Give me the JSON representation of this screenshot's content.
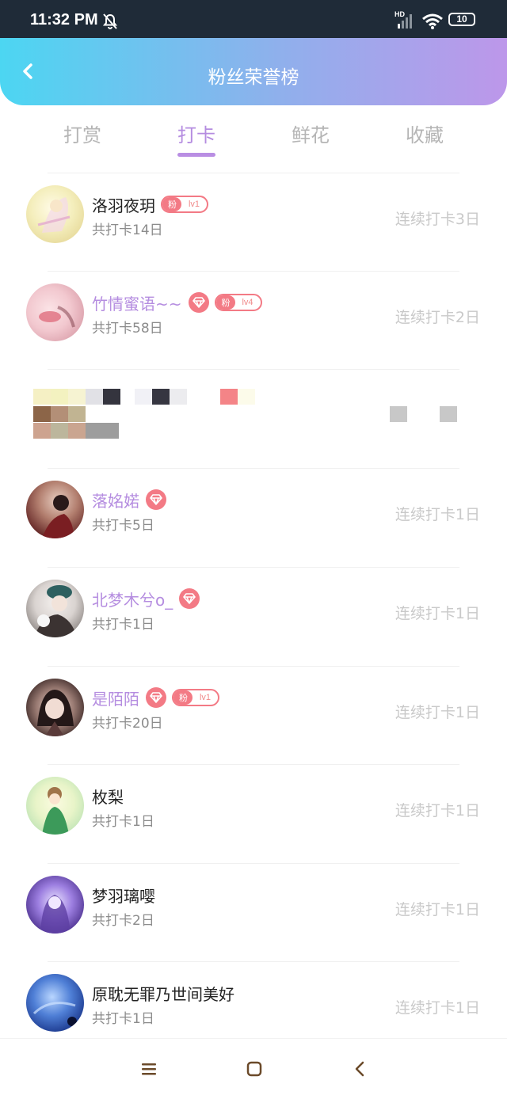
{
  "status": {
    "time": "11:32 PM",
    "battery": "10",
    "hd": "HD"
  },
  "header": {
    "title": "粉丝荣誉榜"
  },
  "tabs": [
    {
      "label": "打赏"
    },
    {
      "label": "打卡"
    },
    {
      "label": "鲜花"
    },
    {
      "label": "收藏"
    }
  ],
  "fan_badge_char": "粉",
  "rows": [
    {
      "name": "洛羽夜玥",
      "days": "共打卡14日",
      "streak": "连续打卡3日",
      "level": "lv1"
    },
    {
      "name": "竹情蜜语~~",
      "days": "共打卡58日",
      "streak": "连续打卡2日",
      "level": "lv4"
    },
    {
      "name": "落姳婼",
      "days": "共打卡5日",
      "streak": "连续打卡1日"
    },
    {
      "name": "北梦木兮o_",
      "days": "共打卡1日",
      "streak": "连续打卡1日"
    },
    {
      "name": "是陌陌",
      "days": "共打卡20日",
      "streak": "连续打卡1日",
      "level": "lv1"
    },
    {
      "name": "枚梨",
      "days": "共打卡1日",
      "streak": "连续打卡1日"
    },
    {
      "name": "梦羽璃嘤",
      "days": "共打卡2日",
      "streak": "连续打卡1日"
    },
    {
      "name": "原耽无罪乃世间美好",
      "days": "共打卡1日",
      "streak": "连续打卡1日"
    }
  ],
  "colors": {
    "accent": "#b58de0",
    "badge": "#f37a85",
    "muted": "#c9c9c9"
  }
}
